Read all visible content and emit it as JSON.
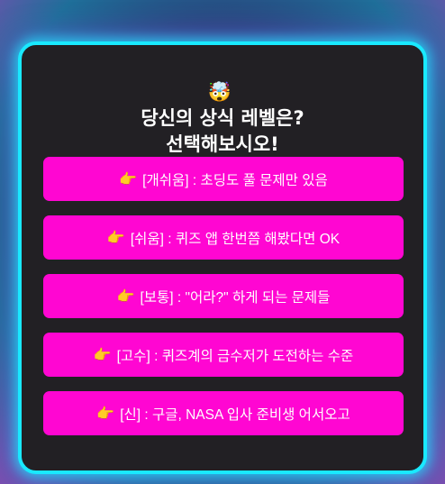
{
  "quiz": {
    "emoji": "🤯",
    "title_line1": "당신의 상식 레벨은?",
    "title_line2": "선택해보시오!",
    "option_icon": "pointing-hand-icon",
    "options": [
      {
        "icon": "👉",
        "label": "[개쉬움] : 초딩도 풀 문제만 있음"
      },
      {
        "icon": "👉",
        "label": "[쉬움] : 퀴즈 앱 한번쯤 해봤다면 OK"
      },
      {
        "icon": "👉",
        "label": "[보통] : \"어라?\" 하게 되는 문제들"
      },
      {
        "icon": "👉",
        "label": "[고수] : 퀴즈계의 금수저가 도전하는 수준"
      },
      {
        "icon": "👉",
        "label": "[신] : 구글, NASA 입사 준비생 어서오고"
      }
    ]
  },
  "colors": {
    "card_border": "#19e9ff",
    "card_bg": "#222024",
    "button_bg": "#ff06d2",
    "text": "#ffffff"
  }
}
